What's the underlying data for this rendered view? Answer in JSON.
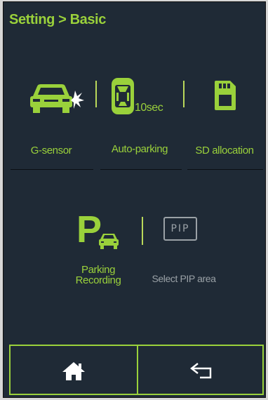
{
  "header": {
    "title": "Setting > Basic"
  },
  "tiles": {
    "gsensor": {
      "label": "G-sensor"
    },
    "autoparking": {
      "label": "Auto-parking",
      "badge": "10sec"
    },
    "sd": {
      "label": "SD allocation"
    },
    "parking": {
      "label_line1": "Parking",
      "label_line2": "Recording"
    },
    "pip": {
      "label": "Select PIP area",
      "icon_text": "PIP"
    }
  },
  "nav": {
    "home_icon": "home-icon",
    "back_icon": "back-arrow-icon"
  },
  "colors": {
    "accent": "#9ad13b",
    "background": "#1f2a36",
    "muted": "#9aa1a6"
  }
}
